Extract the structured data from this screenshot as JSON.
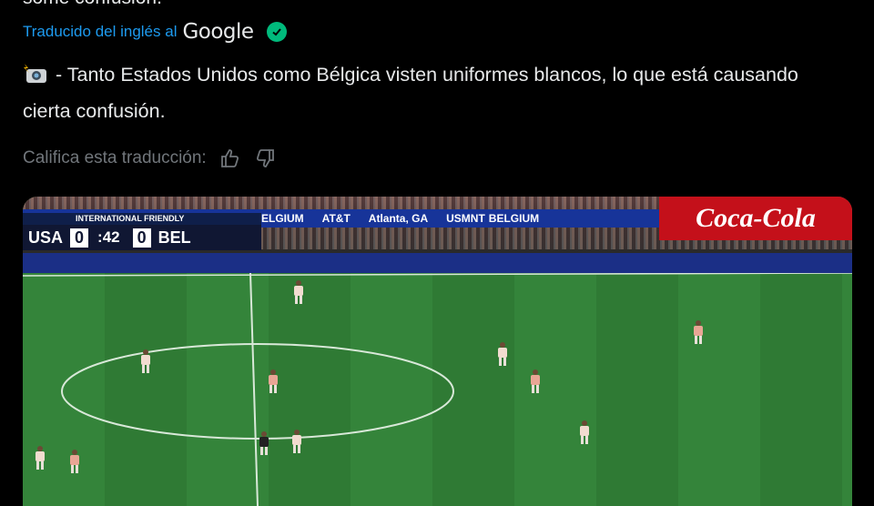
{
  "tweet": {
    "cut_line": "some confusion.",
    "translated_label": "Traducido del inglés al",
    "translator_brand": "Google",
    "translated_text": "- Tanto Estados Unidos como Bélgica visten uniformes blancos, lo que está causando cierta confusión.",
    "rate_label": "Califica esta traducción:",
    "icons": {
      "camera": "camera-flash-icon",
      "thumbs_up": "thumbs-up-icon",
      "thumbs_down": "thumbs-down-icon",
      "verified": "verified-check-icon"
    }
  },
  "media": {
    "scorebug": {
      "competition": "INTERNATIONAL FRIENDLY",
      "home_team": "USA",
      "home_score": "0",
      "clock": ":42",
      "away_score": "0",
      "away_team": "BEL"
    },
    "board": {
      "text1": "ELGIUM",
      "text2": "AT&T",
      "text3": "Atlanta, GA",
      "text4": "USMNT",
      "text5": "BELGIUM"
    },
    "sponsor": "Coca-Cola",
    "colors": {
      "pitch": "#2f7a34",
      "board": "#173499",
      "sponsor_red": "#c4101a"
    }
  },
  "colors": {
    "link": "#1d9bf0",
    "muted": "#71767b",
    "verified": "#00ba7c",
    "text": "#e7e9ea"
  }
}
